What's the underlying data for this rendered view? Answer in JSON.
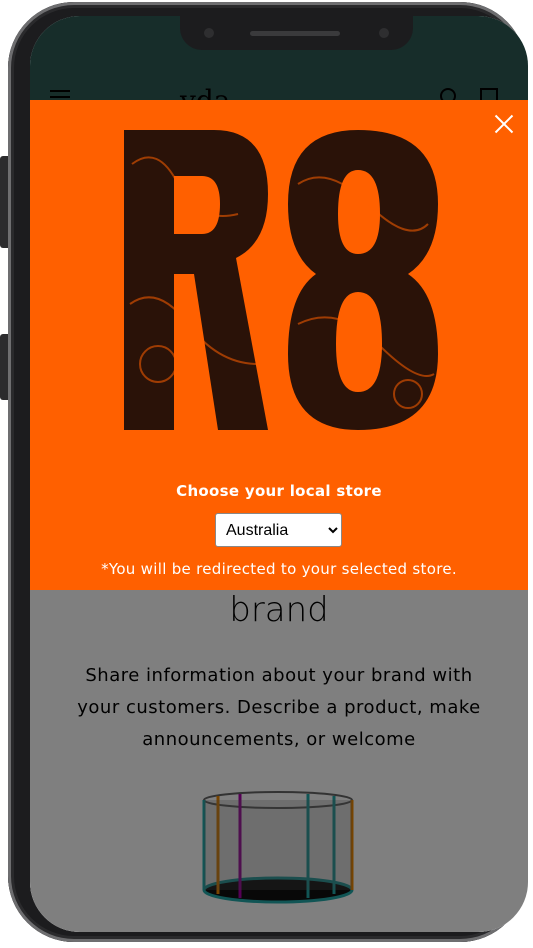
{
  "header": {
    "logo_text": "vda"
  },
  "page": {
    "heading": "brand",
    "body_text": "Share information about your brand with your customers. Describe a product, make announcements, or welcome"
  },
  "modal": {
    "logo_label": "R8",
    "store_title": "Choose your local store",
    "store_selected": "Australia",
    "store_options": [
      "Australia"
    ],
    "redirect_note": "*You will be redirected to your selected store.",
    "close_icon": "close-icon"
  },
  "colors": {
    "modal_bg": "#ff6000",
    "header_bg": "#2f5a55",
    "logo_fill": "#2a1208"
  }
}
